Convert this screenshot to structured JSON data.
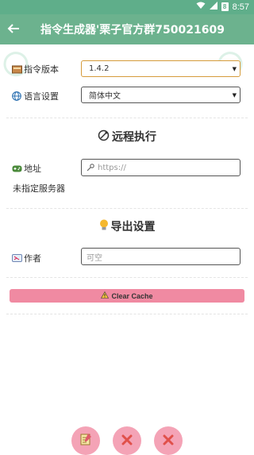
{
  "status_bar": {
    "time": "8:57",
    "notification_count": "8"
  },
  "app_bar": {
    "title": "指令生成器'栗子官方群750021609"
  },
  "fields": {
    "version_label": "指令版本",
    "version_value": "1.4.2",
    "language_label": "语言设置",
    "language_value": "简体中文"
  },
  "remote_section": {
    "title": "远程执行",
    "address_label": "地址",
    "address_placeholder": "https://",
    "server_status": "未指定服务器"
  },
  "export_section": {
    "title": "导出设置",
    "author_label": "作者",
    "author_placeholder": "可空"
  },
  "clear_cache": {
    "label": "Clear Cache"
  },
  "colors": {
    "accent": "#6cb28e",
    "clear_btn": "#f08aa2",
    "fab": "#f4a3b6"
  },
  "icons": {
    "version": "book-icon",
    "language": "globe-icon",
    "remote": "satellite-icon",
    "address": "gamepad-icon",
    "export": "lightbulb-icon",
    "author": "id-card-icon",
    "url": "key-icon",
    "warning": "warning-icon"
  }
}
